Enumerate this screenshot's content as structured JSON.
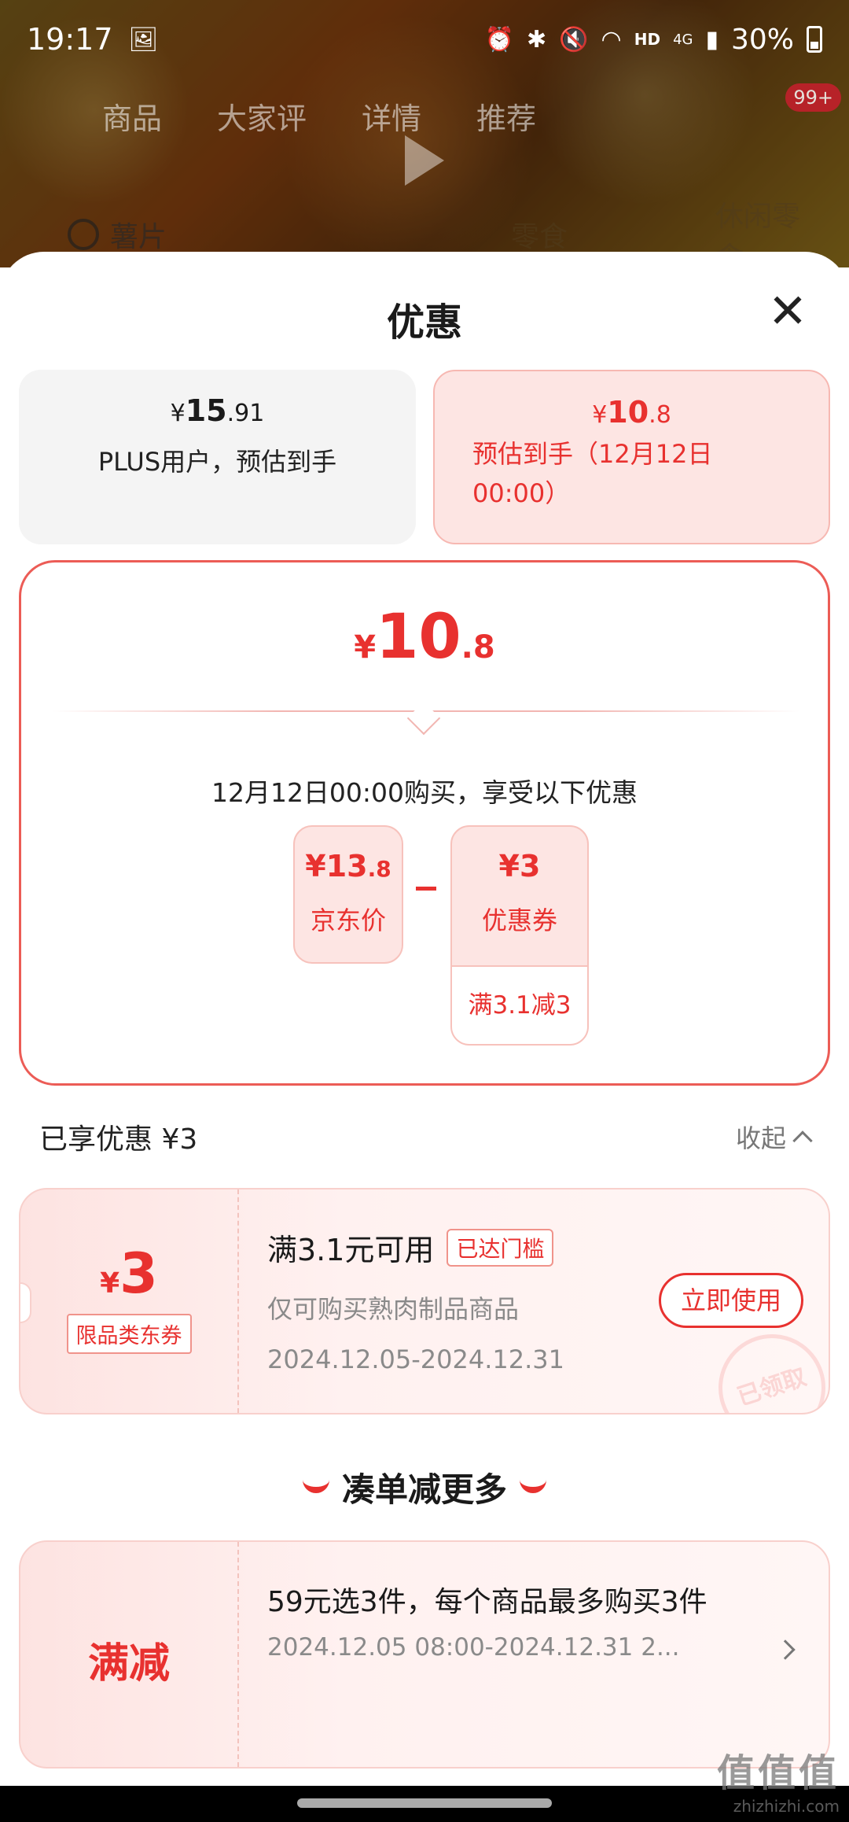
{
  "status_bar": {
    "time": "19:17",
    "network": "HD",
    "signal": "4G",
    "battery": "30%"
  },
  "background": {
    "tabs": [
      "商品",
      "大家评",
      "详情",
      "推荐"
    ],
    "cart_badge": "99+",
    "search_keyword": "薯片",
    "search_tags": [
      "零食",
      "休闲零食"
    ]
  },
  "sheet": {
    "title": "优惠",
    "options": {
      "plus": {
        "price_yen": "¥",
        "price_int": "15",
        "price_dec": ".91",
        "label": "PLUS用户，预估到手"
      },
      "estimate": {
        "price_yen": "¥",
        "price_int": "10",
        "price_dec": ".8",
        "label": "预估到手（12月12日 00:00）"
      }
    },
    "breakdown": {
      "final_yen": "¥",
      "final_int": "10",
      "final_dec": ".8",
      "note": "12月12日00:00购买，享受以下优惠",
      "jd_price": {
        "yen": "¥",
        "int": "13",
        "dec": ".8",
        "label": "京东价"
      },
      "coupon": {
        "yen": "¥",
        "int": "3",
        "label": "优惠券",
        "rule": "满3.1减3"
      }
    },
    "enjoyed": {
      "label": "已享优惠 ¥3",
      "collapse": "收起"
    },
    "coupon_card": {
      "amount_yen": "¥",
      "amount": "3",
      "type": "限品类东券",
      "title": "满3.1元可用",
      "tag": "已达门槛",
      "desc": "仅可购买熟肉制品商品",
      "dates": "2024.12.05-2024.12.31",
      "button": "立即使用",
      "stamp": "已领取"
    },
    "more": {
      "title": "凑单减更多",
      "card": {
        "label": "满减",
        "title": "59元选3件，每个商品最多购买3件",
        "dates": "2024.12.05 08:00-2024.12.31 2..."
      }
    }
  },
  "watermark": {
    "main": "值值值",
    "sub": "zhizhizhi.com"
  },
  "colors": {
    "accent": "#e8312f",
    "card_bg": "#fde5e3"
  }
}
